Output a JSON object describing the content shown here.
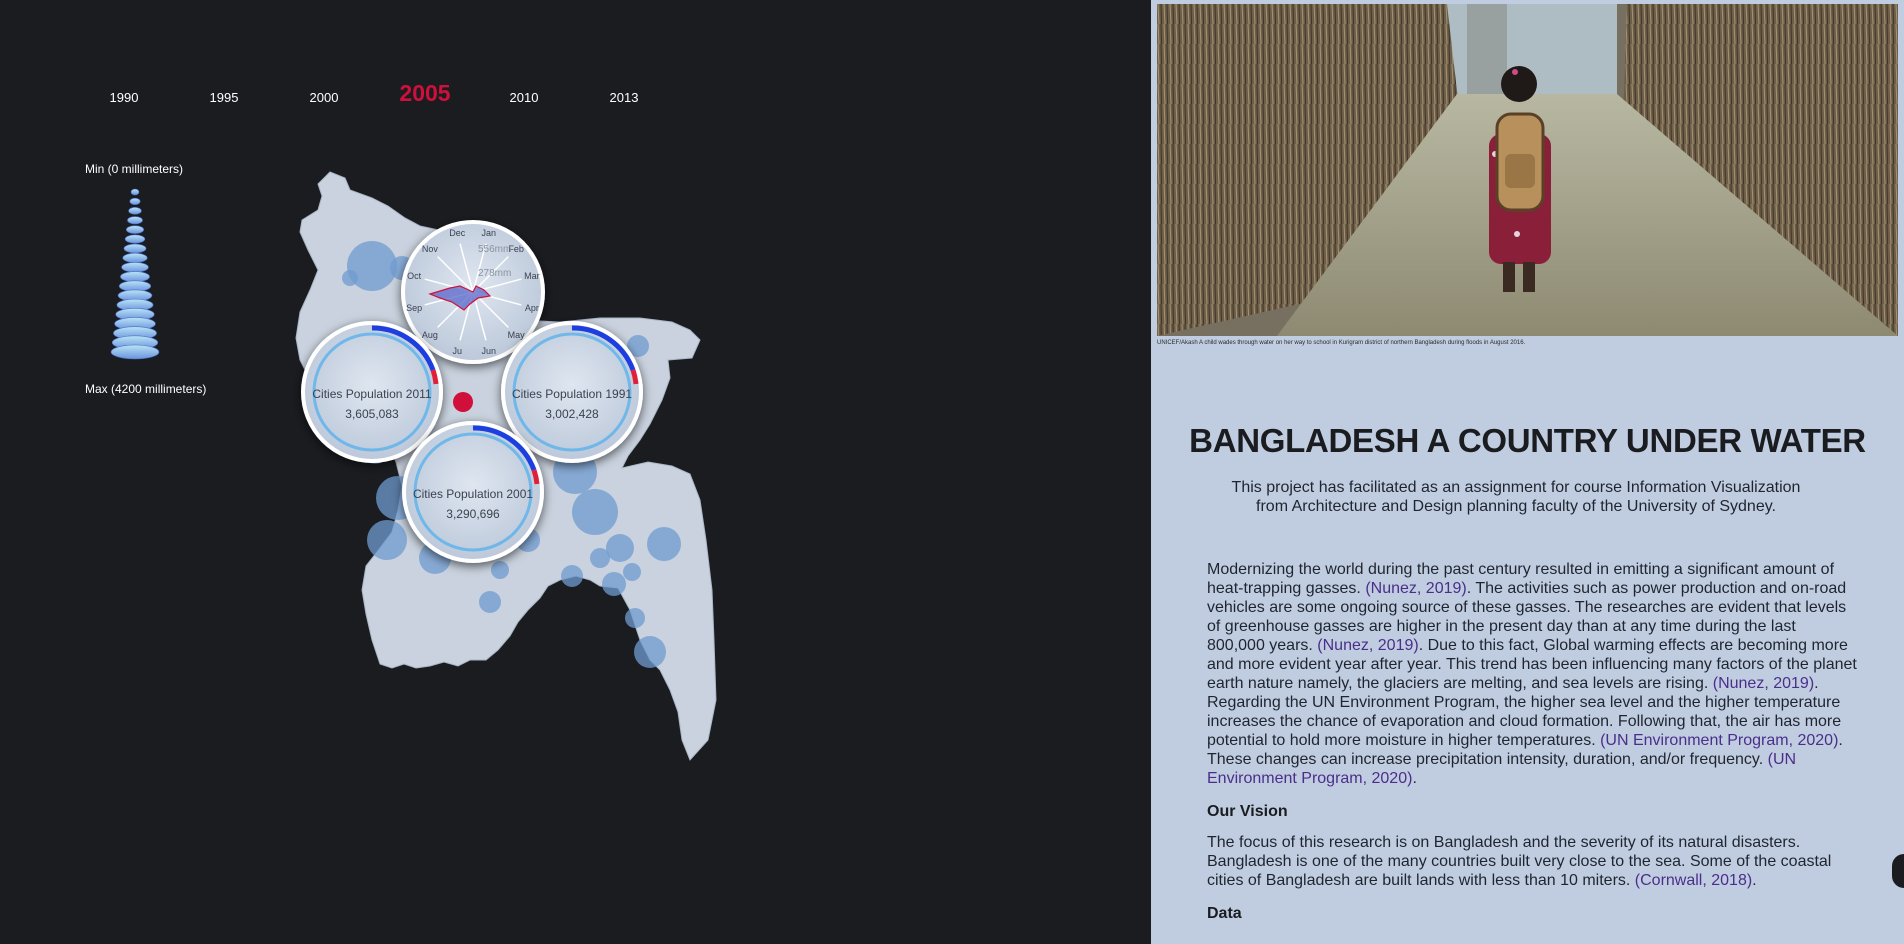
{
  "timeline": {
    "years": [
      "1990",
      "1995",
      "2000",
      "2005",
      "2010",
      "2013"
    ],
    "selected_year": "2005"
  },
  "rain_legend": {
    "min_label": "Min (0 millimeters)",
    "max_label": "Max (4200 millimeters)"
  },
  "radial_chart": {
    "months": [
      "Jan",
      "Feb",
      "Mar",
      "Apr",
      "May",
      "Jun",
      "Ju",
      "Aug",
      "Sep",
      "Oct",
      "Nov",
      "Dec"
    ],
    "scale_labels": [
      "556mm",
      "278mm"
    ]
  },
  "population_badges": [
    {
      "label": "Cities Population 2011",
      "value": "3,605,083"
    },
    {
      "label": "Cities Population 1991",
      "value": "3,002,428"
    },
    {
      "label": "Cities Population 2001",
      "value": "3,290,696"
    }
  ],
  "article": {
    "photo_caption": "UNICEF/Akash A child wades through water on her way to school in Kurigram district of northern Bangladesh during floods in August 2016.",
    "title": "BANGLADESH A COUNTRY UNDER WATER",
    "intro": "This project has facilitated as an assignment for course Information Visualization from Architecture and Design planning faculty of the University of Sydney.",
    "p1": [
      {
        "text": "Modernizing the world during the past century resulted in emitting a significant amount of heat-trapping gasses. "
      },
      {
        "text": "(Nunez, 2019)",
        "cite": true
      },
      {
        "text": ". The activities such as power production and on-road vehicles are some ongoing source of these gasses. The researches are evident that levels of greenhouse gasses are higher in the present day than at any time during the last 800,000 years. "
      },
      {
        "text": "(Nunez, 2019)",
        "cite": true
      },
      {
        "text": ". Due to this fact, Global warming effects are becoming more and more evident year after year. This trend has been influencing many factors of the planet earth nature namely, the glaciers are melting, and sea levels are rising. "
      },
      {
        "text": "(Nunez, 2019)",
        "cite": true
      },
      {
        "text": ". Regarding the UN Environment Program, the higher sea level and the higher temperature increases the chance of evaporation and cloud formation. Following that, the air has more potential to hold more moisture in higher temperatures. "
      },
      {
        "text": "(UN Environment Program, 2020)",
        "cite": true
      },
      {
        "text": ". These changes can increase precipitation intensity, duration, and/or frequency. "
      },
      {
        "text": "(UN Environment Program, 2020)",
        "cite": true
      },
      {
        "text": "."
      }
    ],
    "vision_heading": "Our Vision",
    "p2": [
      {
        "text": "The focus of this research is on Bangladesh and the severity of its natural disasters. Bangladesh is one of the many countries built very close to the sea. Some of the coastal cities of Bangladesh are built lands with less than 10 miters. "
      },
      {
        "text": "(Cornwall, 2018)",
        "cite": true
      },
      {
        "text": "."
      }
    ],
    "data_heading": "Data"
  },
  "colors": {
    "background": "#1a1c20",
    "panel": "#c0cde0",
    "accent_red": "#d0103a",
    "bubble_blue": "#6f9bd0",
    "citation": "#4b2e8a"
  }
}
